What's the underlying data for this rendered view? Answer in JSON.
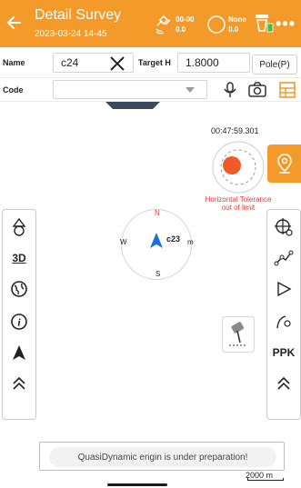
{
  "header": {
    "title": "Detail Survey",
    "datetime": "2023-03-24 14-45",
    "satellite": {
      "line1": "00-00",
      "line2": "0.0"
    },
    "solution": {
      "line1": "None",
      "line2": "0.0"
    },
    "more": "•••"
  },
  "form": {
    "name_label": "Name",
    "name_value": "c24",
    "target_h_label": "Target H",
    "target_h_value": "1.8000",
    "pole_label": "Pole(P)",
    "code_label": "Code",
    "code_value": ""
  },
  "map": {
    "timer": "00:47:59.301",
    "tolerance_text": "Horizontal Tolerance out of limit",
    "point_label": "c23",
    "compass": {
      "n": "N",
      "s": "S",
      "w": "W",
      "e": "m"
    },
    "left_toolbar": {
      "view3d": "3D"
    },
    "right_toolbar": {
      "ppk": "PPK"
    },
    "toast": "QuasiDynamic engin is under preparation!",
    "scale": "2000 m"
  },
  "colors": {
    "accent": "#f39a2b",
    "warning": "#e53935",
    "point": "#f05a28",
    "arrow": "#1e6fd9"
  }
}
